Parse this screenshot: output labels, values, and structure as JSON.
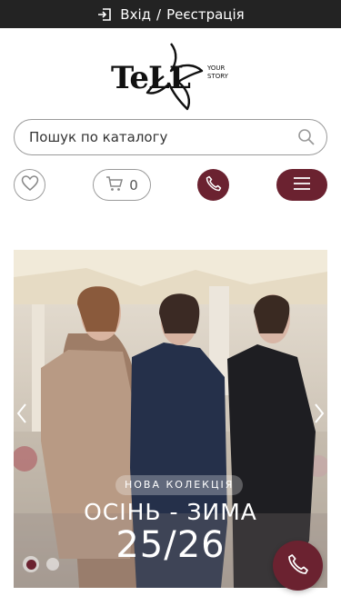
{
  "topbar": {
    "login_label": "Вхід",
    "separator": "/",
    "register_label": "Реєстрація"
  },
  "logo": {
    "word": "TeLL",
    "tagline_line1": "YOUR",
    "tagline_line2": "STORY"
  },
  "search": {
    "placeholder": "Пошук по каталогу"
  },
  "cart": {
    "count": "0"
  },
  "banner": {
    "badge": "НОВА КОЛЕКЦІЯ",
    "title": "ОСІНЬ - ЗИМА",
    "years": "25/26",
    "slides_total": 2,
    "active_slide": 1
  },
  "colors": {
    "accent": "#6b2230",
    "topbar": "#232323"
  },
  "icons": [
    "login-icon",
    "search-icon",
    "heart-icon",
    "cart-icon",
    "phone-icon",
    "menu-icon",
    "chevron-left-icon",
    "chevron-right-icon"
  ]
}
